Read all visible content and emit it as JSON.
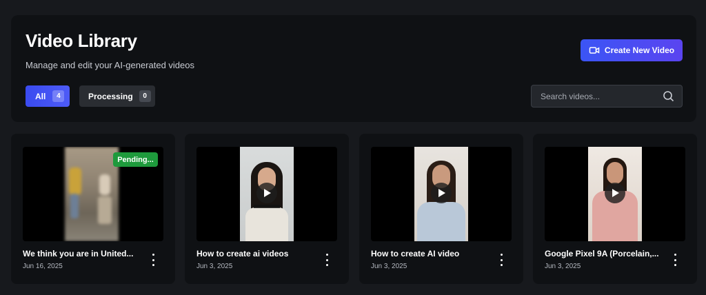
{
  "header": {
    "title": "Video Library",
    "subtitle": "Manage and edit your AI-generated videos",
    "create_label": "Create New Video"
  },
  "filters": [
    {
      "label": "All",
      "count": "4",
      "active": true
    },
    {
      "label": "Processing",
      "count": "0",
      "active": false
    }
  ],
  "search": {
    "placeholder": "Search videos...",
    "value": "",
    "icon": "search-icon"
  },
  "colors": {
    "accent": "#3b55f5",
    "pending": "#1e9a3c",
    "panel": "#0f1114",
    "background": "#17191d"
  },
  "videos": [
    {
      "title": "We think you are in United...",
      "date": "Jun 16, 2025",
      "status": "Pending...",
      "menu_icon": "kebab-icon"
    },
    {
      "title": "How to create ai videos",
      "date": "Jun 3, 2025",
      "menu_icon": "kebab-icon"
    },
    {
      "title": "How to create AI video",
      "date": "Jun 3, 2025",
      "menu_icon": "kebab-icon"
    },
    {
      "title": "Google Pixel 9A (Porcelain,...",
      "date": "Jun 3, 2025",
      "menu_icon": "kebab-icon"
    }
  ]
}
